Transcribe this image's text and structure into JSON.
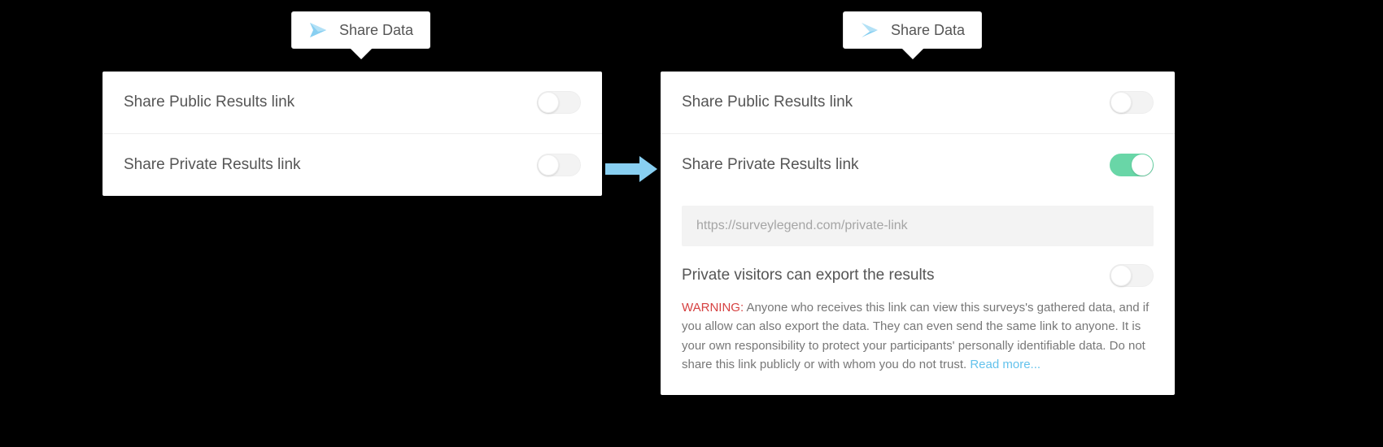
{
  "left_tab": {
    "title": "Share Data"
  },
  "right_tab": {
    "title": "Share Data"
  },
  "left_panel": {
    "row1": {
      "label": "Share Public Results link"
    },
    "row2": {
      "label": "Share Private Results link"
    }
  },
  "right_panel": {
    "row1": {
      "label": "Share Public Results link"
    },
    "row2": {
      "label": "Share Private Results link"
    },
    "private_link": "https://surveylegend.com/private-link",
    "export_row": {
      "label": "Private visitors can export the results"
    },
    "warning_label": "WARNING:",
    "warning_text": " Anyone  who receives this link can view this surveys's gathered data, and if you allow can also export the data. They can even send the same link to anyone. It is your own responsibility to protect your participants' personally identifiable data. Do not share this link publicly or with whom you do not trust. ",
    "read_more": "Read more..."
  },
  "colors": {
    "accent_blue": "#88cff1",
    "toggle_on": "#69d6a7",
    "warning_red": "#d64141"
  }
}
